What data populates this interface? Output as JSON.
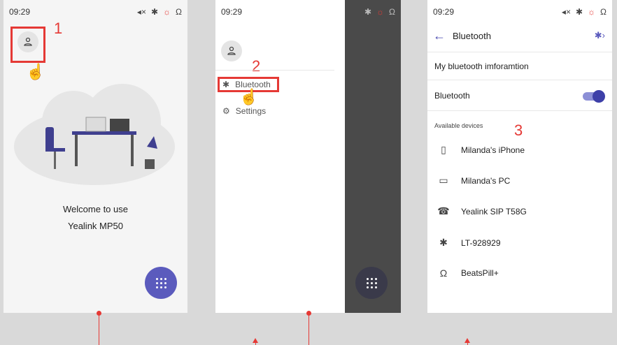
{
  "screen1": {
    "time": "09:29",
    "step": "1",
    "welcome_line1": "Welcome to use",
    "welcome_line2": "Yealink MP50"
  },
  "screen2": {
    "time": "09:29",
    "step": "2",
    "menu": [
      "Bluetooth",
      "Settings"
    ]
  },
  "screen3": {
    "time": "09:29",
    "title": "Bluetooth",
    "info_row": "My bluetooth imforamtion",
    "toggle_label": "Bluetooth",
    "toggle_on": true,
    "section": "Available devices",
    "step": "3",
    "devices": [
      {
        "name": "Milanda's iPhone",
        "icon": "phone-icon"
      },
      {
        "name": "Milanda's PC",
        "icon": "laptop-icon"
      },
      {
        "name": "Yealink SIP T58G",
        "icon": "desk-phone-icon"
      },
      {
        "name": "LT-928929",
        "icon": "bluetooth-settings-icon"
      },
      {
        "name": "BeatsPill+",
        "icon": "headphones-icon"
      }
    ]
  },
  "colors": {
    "accent": "#5b5bbd",
    "highlight": "#e53935"
  }
}
